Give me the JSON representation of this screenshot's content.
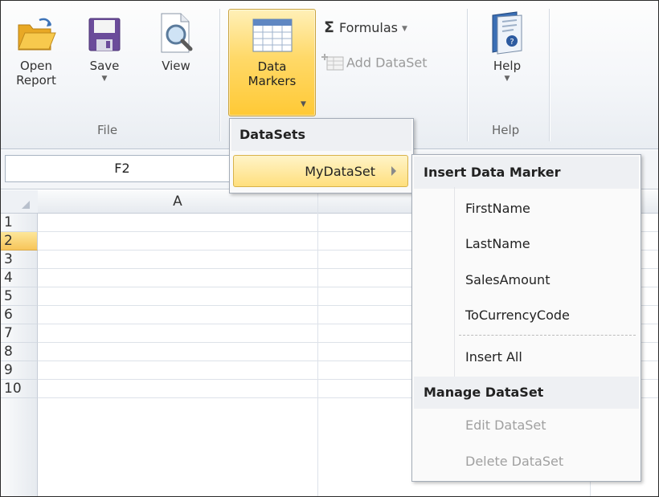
{
  "ribbon": {
    "file_group": {
      "label": "File",
      "open_label": "Open\nReport",
      "save_label": "Save",
      "view_label": "View"
    },
    "data_markers_label": "Data\nMarkers",
    "formulas_label": "Formulas",
    "add_dataset_label": "Add DataSet",
    "help_group": {
      "label": "Help",
      "help_label": "Help"
    }
  },
  "namebox": {
    "value": "F2"
  },
  "grid": {
    "columns": [
      "A"
    ],
    "rows": [
      "1",
      "2",
      "3",
      "4",
      "5",
      "6",
      "7",
      "8",
      "9",
      "10"
    ],
    "selected_row": "2"
  },
  "datasets_menu": {
    "header": "DataSets",
    "item": "MyDataSet"
  },
  "submenu": {
    "insert_header": "Insert Data Marker",
    "fields": [
      "FirstName",
      "LastName",
      "SalesAmount",
      "ToCurrencyCode"
    ],
    "insert_all": "Insert All",
    "manage_header": "Manage DataSet",
    "edit": "Edit DataSet",
    "delete": "Delete DataSet"
  },
  "colors": {
    "accent": "#ffd969",
    "selected_row": "#f7c55a"
  }
}
